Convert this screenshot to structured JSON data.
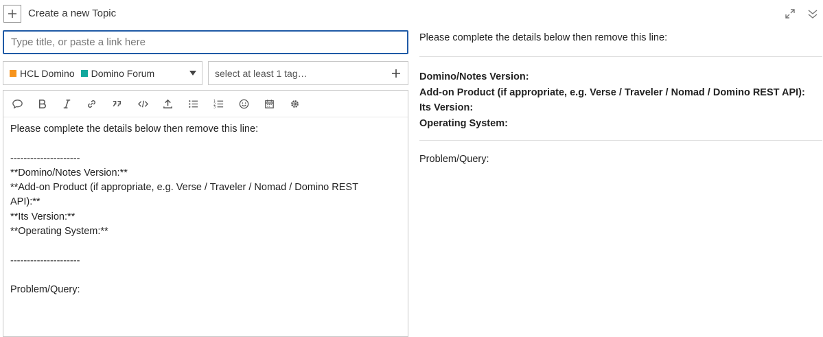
{
  "header": {
    "title": "Create a new Topic"
  },
  "title_input": {
    "placeholder": "Type title, or paste a link here",
    "value": ""
  },
  "category": {
    "parent": "HCL Domino",
    "parent_color": "#f7941d",
    "child": "Domino Forum",
    "child_color": "#12a89d"
  },
  "tags": {
    "placeholder": "select at least 1 tag…"
  },
  "toolbar": {
    "items": [
      "quote-icon",
      "bold-icon",
      "italic-icon",
      "link-icon",
      "blockquote-icon",
      "code-icon",
      "upload-icon",
      "bullet-list-icon",
      "numbered-list-icon",
      "emoji-icon",
      "calendar-icon",
      "gear-icon"
    ]
  },
  "editor": {
    "text": "Please complete the details below then remove this line:\n\n---------------------\n**Domino/Notes Version:**\n**Add-on Product (if appropriate, e.g. Verse / Traveler / Nomad / Domino REST API):**\n**Its Version:**\n**Operating System:**\n\n---------------------\n\nProblem/Query:"
  },
  "preview": {
    "intro": "Please complete the details below then remove this line:",
    "fields": [
      "Domino/Notes Version:",
      "Add-on Product (if appropriate, e.g. Verse / Traveler / Nomad / Domino REST API):",
      "Its Version:",
      "Operating System:"
    ],
    "problem": "Problem/Query:"
  }
}
